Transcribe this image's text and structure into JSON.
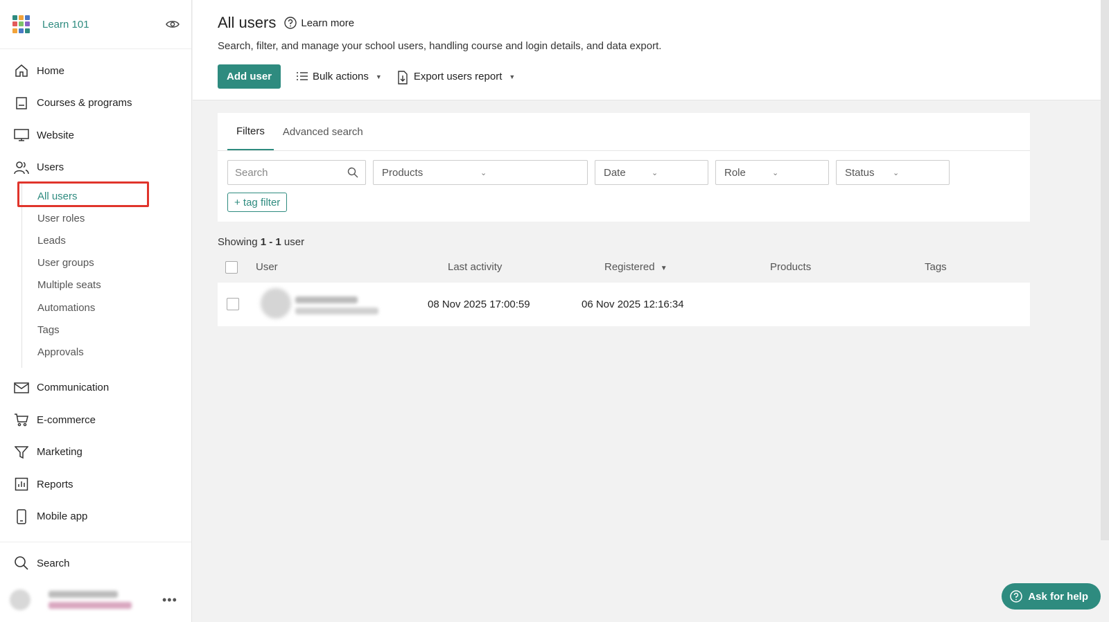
{
  "brand": {
    "name": "Learn 101",
    "logo_colors": [
      "#2e8b7f",
      "#f2a33a",
      "#4a78c5",
      "#e25b5b",
      "#7cc36a",
      "#8a63c7",
      "#f2a33a",
      "#4a78c5",
      "#2e8b7f"
    ]
  },
  "sidebar": {
    "items": [
      {
        "label": "Home",
        "icon": "home-icon"
      },
      {
        "label": "Courses & programs",
        "icon": "book-icon"
      },
      {
        "label": "Website",
        "icon": "monitor-icon"
      },
      {
        "label": "Users",
        "icon": "users-icon"
      }
    ],
    "users_sub": [
      {
        "label": "All users",
        "active": true
      },
      {
        "label": "User roles"
      },
      {
        "label": "Leads"
      },
      {
        "label": "User groups"
      },
      {
        "label": "Multiple seats"
      },
      {
        "label": "Automations"
      },
      {
        "label": "Tags"
      },
      {
        "label": "Approvals"
      }
    ],
    "items_after": [
      {
        "label": "Communication",
        "icon": "mail-icon"
      },
      {
        "label": "E-commerce",
        "icon": "cart-icon"
      },
      {
        "label": "Marketing",
        "icon": "funnel-icon"
      },
      {
        "label": "Reports",
        "icon": "chart-icon"
      },
      {
        "label": "Mobile app",
        "icon": "phone-icon"
      }
    ],
    "search_label": "Search"
  },
  "header": {
    "title": "All users",
    "learn_more": "Learn more",
    "subtitle": "Search, filter, and manage your school users, handling course and login details, and data export.",
    "add_user": "Add user",
    "bulk_actions": "Bulk actions",
    "export_report": "Export users report"
  },
  "filters": {
    "tabs": [
      "Filters",
      "Advanced search"
    ],
    "search_placeholder": "Search",
    "selects": [
      "Products",
      "Date",
      "Role",
      "Status"
    ],
    "tag_filter": "+ tag filter"
  },
  "results": {
    "showing_prefix": "Showing",
    "range": "1 - 1",
    "suffix": "user"
  },
  "table": {
    "columns": [
      "User",
      "Last activity",
      "Registered",
      "Products",
      "Tags"
    ],
    "sort_indicator": "▼",
    "rows": [
      {
        "last_activity": "08 Nov 2025 17:00:59",
        "registered": "06 Nov 2025 12:16:34"
      }
    ]
  },
  "help_button": "Ask for help",
  "accent_color": "#2e8b7f"
}
